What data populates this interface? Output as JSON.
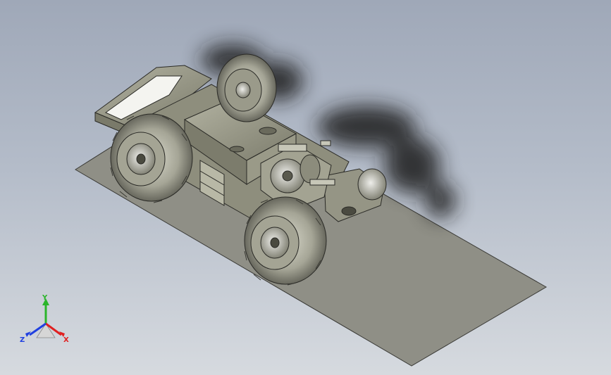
{
  "view": {
    "background_top": "#9fa8b8",
    "background_bottom": "#d6dadf",
    "ground_color": "#8f8f86",
    "model_color": "#9a9a86",
    "shadow_color": "#1e1e1e"
  },
  "triad": {
    "y_label": "Y",
    "x_label": "X",
    "z_label": "Z",
    "y_color": "#2bb52b",
    "x_color": "#e02020",
    "z_color": "#2040e0"
  }
}
